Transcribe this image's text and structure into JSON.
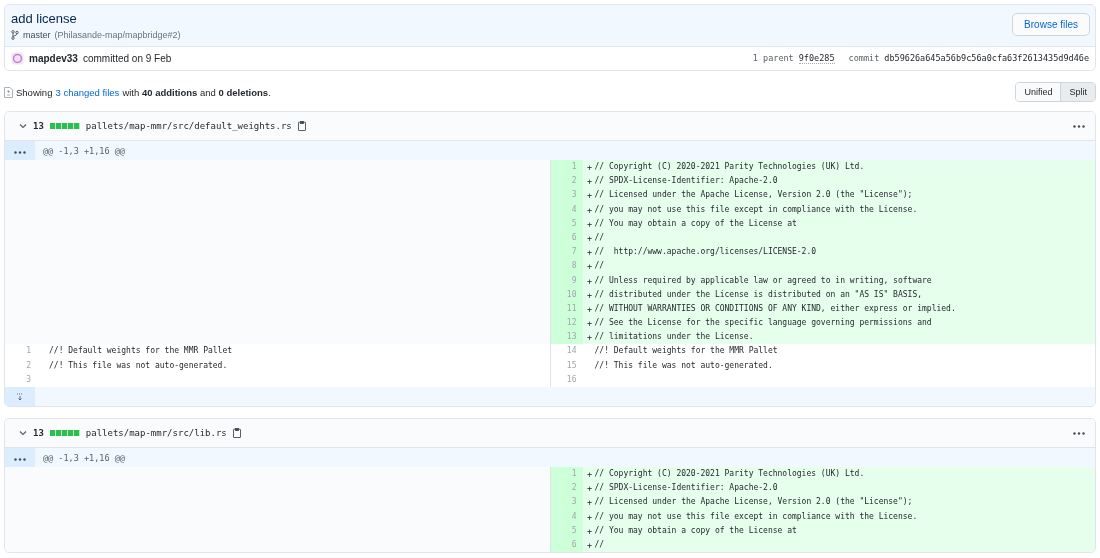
{
  "commit": {
    "title": "add license",
    "branch": "master",
    "pr_ref": "(Philasande-map/mapbridge#2)",
    "browse_button": "Browse files",
    "author": "mapdev33",
    "committed": "committed on 9 Feb",
    "parents_label": "1 parent",
    "parent_sha": "9f0e285",
    "commit_label": "commit",
    "commit_sha": "db59626a645a56b9c56a0cfa63f2613435d9d46e"
  },
  "summary": {
    "prefix": "Showing",
    "files_link": "3 changed files",
    "text": "with **40 additions** and **0 deletions**."
  },
  "view_toggle": [
    {
      "label": "Unified",
      "selected": false
    },
    {
      "label": "Split",
      "selected": true
    }
  ],
  "files": [
    {
      "stat": "13",
      "path": "pallets/map-mmr/src/default_weights.rs",
      "hunk": "@@ -1,3 +1,16 @@",
      "expander": true,
      "rows": [
        {
          "right": {
            "kind": "added",
            "num": "1",
            "sign": "+",
            "text": "// Copyright (C) 2020-2021 Parity Technologies (UK) Ltd."
          }
        },
        {
          "right": {
            "kind": "added",
            "num": "2",
            "sign": "+",
            "text": "// SPDX-License-Identifier: Apache-2.0"
          }
        },
        {
          "right": {
            "kind": "added",
            "num": "3",
            "sign": "+",
            "text": "// Licensed under the Apache License, Version 2.0 (the \"License\");"
          }
        },
        {
          "right": {
            "kind": "added",
            "num": "4",
            "sign": "+",
            "text": "// you may not use this file except in compliance with the License."
          }
        },
        {
          "right": {
            "kind": "added",
            "num": "5",
            "sign": "+",
            "text": "// You may obtain a copy of the License at"
          }
        },
        {
          "right": {
            "kind": "added",
            "num": "6",
            "sign": "+",
            "text": "//"
          }
        },
        {
          "right": {
            "kind": "added",
            "num": "7",
            "sign": "+",
            "text": "//  http://www.apache.org/licenses/LICENSE-2.0"
          }
        },
        {
          "right": {
            "kind": "added",
            "num": "8",
            "sign": "+",
            "text": "//"
          }
        },
        {
          "right": {
            "kind": "added",
            "num": "9",
            "sign": "+",
            "text": "// Unless required by applicable law or agreed to in writing, software"
          }
        },
        {
          "right": {
            "kind": "added",
            "num": "10",
            "sign": "+",
            "text": "// distributed under the License is distributed on an \"AS IS\" BASIS,"
          }
        },
        {
          "right": {
            "kind": "added",
            "num": "11",
            "sign": "+",
            "text": "// WITHOUT WARRANTIES OR CONDITIONS OF ANY KIND, either express or implied."
          }
        },
        {
          "right": {
            "kind": "added",
            "num": "12",
            "sign": "+",
            "text": "// See the License for the specific language governing permissions and"
          }
        },
        {
          "right": {
            "kind": "added",
            "num": "13",
            "sign": "+",
            "text": "// limitations under the License."
          }
        },
        {
          "left": {
            "kind": "context",
            "num": "1",
            "text": "//! Default weights for the MMR Pallet"
          },
          "right": {
            "kind": "context",
            "num": "14",
            "text": "//! Default weights for the MMR Pallet"
          }
        },
        {
          "left": {
            "kind": "context",
            "num": "2",
            "text": "//! This file was not auto-generated."
          },
          "right": {
            "kind": "context",
            "num": "15",
            "text": "//! This file was not auto-generated."
          }
        },
        {
          "left": {
            "kind": "context",
            "num": "3"
          },
          "right": {
            "kind": "context",
            "num": "16"
          }
        }
      ]
    },
    {
      "stat": "13",
      "path": "pallets/map-mmr/src/lib.rs",
      "hunk": "@@ -1,3 +1,16 @@",
      "expander": false,
      "rows": [
        {
          "right": {
            "kind": "added",
            "num": "1",
            "sign": "+",
            "text": "// Copyright (C) 2020-2021 Parity Technologies (UK) Ltd."
          }
        },
        {
          "right": {
            "kind": "added",
            "num": "2",
            "sign": "+",
            "text": "// SPDX-License-Identifier: Apache-2.0"
          }
        },
        {
          "right": {
            "kind": "added",
            "num": "3",
            "sign": "+",
            "text": "// Licensed under the Apache License, Version 2.0 (the \"License\");"
          }
        },
        {
          "right": {
            "kind": "added",
            "num": "4",
            "sign": "+",
            "text": "// you may not use this file except in compliance with the License."
          }
        },
        {
          "right": {
            "kind": "added",
            "num": "5",
            "sign": "+",
            "text": "// You may obtain a copy of the License at"
          }
        },
        {
          "right": {
            "kind": "added",
            "num": "6",
            "sign": "+",
            "text": "//"
          }
        }
      ]
    }
  ]
}
